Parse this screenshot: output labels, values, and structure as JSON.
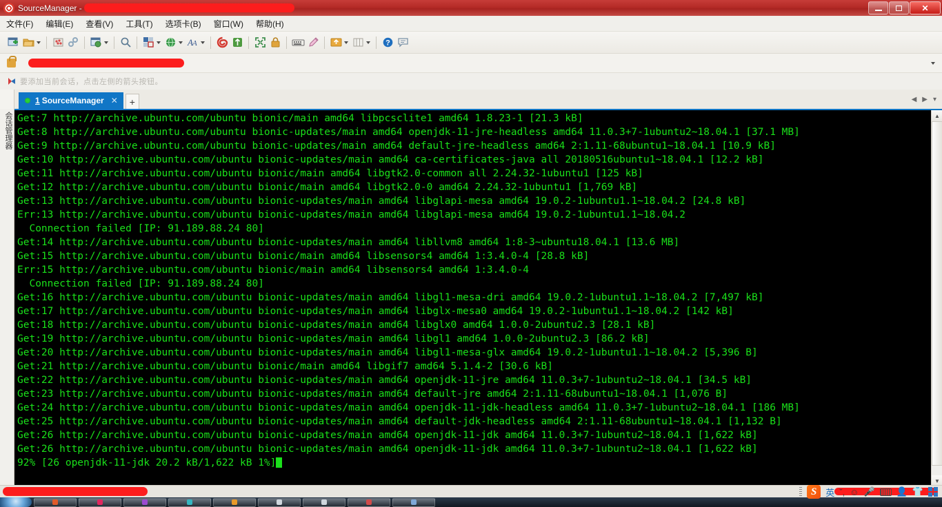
{
  "window": {
    "app_icon": "spiral-icon",
    "title": "SourceManager -",
    "title_redacted": true,
    "controls": {
      "minimize": "minimize-button",
      "maximize": "maximize-button",
      "close": "✕"
    }
  },
  "menubar": {
    "items": [
      {
        "label": "文件(F)",
        "name": "menu-file"
      },
      {
        "label": "编辑(E)",
        "name": "menu-edit"
      },
      {
        "label": "查看(V)",
        "name": "menu-view"
      },
      {
        "label": "工具(T)",
        "name": "menu-tools"
      },
      {
        "label": "选项卡(B)",
        "name": "menu-tabs"
      },
      {
        "label": "窗口(W)",
        "name": "menu-window"
      },
      {
        "label": "帮助(H)",
        "name": "menu-help"
      }
    ]
  },
  "toolbar": {
    "buttons": [
      {
        "name": "new-session-icon",
        "glyph": "▤",
        "color": "#4a80c0",
        "dropdown": false
      },
      {
        "name": "open-folder-icon",
        "glyph": "▰",
        "color": "#e2a33c",
        "dropdown": true
      },
      {
        "name": "disconnect-icon",
        "glyph": "✻",
        "color": "#d05a5a",
        "dropdown": false
      },
      {
        "name": "connect-chain-icon",
        "glyph": "⚯",
        "color": "#8fa8bd",
        "dropdown": false
      },
      {
        "name": "clone-session-icon",
        "glyph": "▣",
        "color": "#3f8f4f",
        "dropdown": true
      },
      {
        "name": "search-icon",
        "glyph": "🔍",
        "color": "#5b7a93",
        "dropdown": false
      },
      {
        "name": "layout-icon",
        "glyph": "▦",
        "color": "#c85050",
        "dropdown": true
      },
      {
        "name": "globe-icon",
        "glyph": "●",
        "color": "#2f8f4f",
        "dropdown": true
      },
      {
        "name": "font-icon",
        "glyph": "A",
        "color": "#3a5a8f",
        "dropdown": true
      },
      {
        "name": "log-session-icon",
        "glyph": "◉",
        "color": "#d4382f",
        "dropdown": false
      },
      {
        "name": "transfer-icon",
        "glyph": "⇄",
        "color": "#4e9a3f",
        "dropdown": false
      },
      {
        "name": "fullscreen-icon",
        "glyph": "⤢",
        "color": "#3f8f4f",
        "dropdown": false
      },
      {
        "name": "lock-icon",
        "glyph": "🔒",
        "color": "#d0a044",
        "dropdown": false
      },
      {
        "name": "keyboard-icon",
        "glyph": "⌨",
        "color": "#6b6b6b",
        "dropdown": false
      },
      {
        "name": "highlighter-icon",
        "glyph": "✎",
        "color": "#c46ba0",
        "dropdown": false
      },
      {
        "name": "upload-icon",
        "glyph": "▲",
        "color": "#e0a43c",
        "dropdown": true
      },
      {
        "name": "columns-icon",
        "glyph": "▥",
        "color": "#9a9a9a",
        "dropdown": true
      },
      {
        "name": "help-icon",
        "glyph": "?",
        "color": "#1f6fbf",
        "dropdown": false
      },
      {
        "name": "chat-icon",
        "glyph": "💬",
        "color": "#7b93a8",
        "dropdown": false
      }
    ]
  },
  "notification": {
    "lock_icon": "lock-icon",
    "redacted": true,
    "dropdown_caret": "▼"
  },
  "hint": {
    "icon": "flag-icon",
    "text": "要添加当前会话，点击左侧的箭头按钮。"
  },
  "sidebar": {
    "handle_glyph": "⟩⟨",
    "label": "会话管理器"
  },
  "tabs": {
    "items": [
      {
        "number": "1",
        "label": "SourceManager",
        "status_dot": "#2ad23a",
        "close": "✕",
        "active": true
      }
    ],
    "add_label": "+",
    "nav_left": "◀",
    "nav_right": "▶",
    "nav_menu": "▾"
  },
  "terminal": {
    "foreground": "#1ae01a",
    "background": "#000000",
    "lines": [
      "Get:7 http://archive.ubuntu.com/ubuntu bionic/main amd64 libpcsclite1 amd64 1.8.23-1 [21.3 kB]",
      "Get:8 http://archive.ubuntu.com/ubuntu bionic-updates/main amd64 openjdk-11-jre-headless amd64 11.0.3+7-1ubuntu2~18.04.1 [37.1 MB]",
      "Get:9 http://archive.ubuntu.com/ubuntu bionic-updates/main amd64 default-jre-headless amd64 2:1.11-68ubuntu1~18.04.1 [10.9 kB]",
      "Get:10 http://archive.ubuntu.com/ubuntu bionic-updates/main amd64 ca-certificates-java all 20180516ubuntu1~18.04.1 [12.2 kB]",
      "Get:11 http://archive.ubuntu.com/ubuntu bionic/main amd64 libgtk2.0-common all 2.24.32-1ubuntu1 [125 kB]",
      "Get:12 http://archive.ubuntu.com/ubuntu bionic/main amd64 libgtk2.0-0 amd64 2.24.32-1ubuntu1 [1,769 kB]",
      "Get:13 http://archive.ubuntu.com/ubuntu bionic-updates/main amd64 libglapi-mesa amd64 19.0.2-1ubuntu1.1~18.04.2 [24.8 kB]",
      "Err:13 http://archive.ubuntu.com/ubuntu bionic-updates/main amd64 libglapi-mesa amd64 19.0.2-1ubuntu1.1~18.04.2",
      "  Connection failed [IP: 91.189.88.24 80]",
      "Get:14 http://archive.ubuntu.com/ubuntu bionic-updates/main amd64 libllvm8 amd64 1:8-3~ubuntu18.04.1 [13.6 MB]",
      "Get:15 http://archive.ubuntu.com/ubuntu bionic/main amd64 libsensors4 amd64 1:3.4.0-4 [28.8 kB]",
      "Err:15 http://archive.ubuntu.com/ubuntu bionic/main amd64 libsensors4 amd64 1:3.4.0-4",
      "  Connection failed [IP: 91.189.88.24 80]",
      "Get:16 http://archive.ubuntu.com/ubuntu bionic-updates/main amd64 libgl1-mesa-dri amd64 19.0.2-1ubuntu1.1~18.04.2 [7,497 kB]",
      "Get:17 http://archive.ubuntu.com/ubuntu bionic-updates/main amd64 libglx-mesa0 amd64 19.0.2-1ubuntu1.1~18.04.2 [142 kB]",
      "Get:18 http://archive.ubuntu.com/ubuntu bionic-updates/main amd64 libglx0 amd64 1.0.0-2ubuntu2.3 [28.1 kB]",
      "Get:19 http://archive.ubuntu.com/ubuntu bionic-updates/main amd64 libgl1 amd64 1.0.0-2ubuntu2.3 [86.2 kB]",
      "Get:20 http://archive.ubuntu.com/ubuntu bionic-updates/main amd64 libgl1-mesa-glx amd64 19.0.2-1ubuntu1.1~18.04.2 [5,396 B]",
      "Get:21 http://archive.ubuntu.com/ubuntu bionic/main amd64 libgif7 amd64 5.1.4-2 [30.6 kB]",
      "Get:22 http://archive.ubuntu.com/ubuntu bionic-updates/main amd64 openjdk-11-jre amd64 11.0.3+7-1ubuntu2~18.04.1 [34.5 kB]",
      "Get:23 http://archive.ubuntu.com/ubuntu bionic-updates/main amd64 default-jre amd64 2:1.11-68ubuntu1~18.04.1 [1,076 B]",
      "Get:24 http://archive.ubuntu.com/ubuntu bionic-updates/main amd64 openjdk-11-jdk-headless amd64 11.0.3+7-1ubuntu2~18.04.1 [186 MB]",
      "Get:25 http://archive.ubuntu.com/ubuntu bionic-updates/main amd64 default-jdk-headless amd64 2:1.11-68ubuntu1~18.04.1 [1,132 B]",
      "Get:26 http://archive.ubuntu.com/ubuntu bionic-updates/main amd64 openjdk-11-jdk amd64 11.0.3+7-1ubuntu2~18.04.1 [1,622 kB]",
      "Get:26 http://archive.ubuntu.com/ubuntu bionic-updates/main amd64 openjdk-11-jdk amd64 11.0.3+7-1ubuntu2~18.04.1 [1,622 kB]"
    ],
    "progress_line": "92% [26 openjdk-11-jdk 20.2 kB/1,622 kB 1%]",
    "progress_total_percent": "92%",
    "progress_item": "26 openjdk-11-jdk",
    "progress_downloaded": "20.2 kB",
    "progress_size": "1,622 kB",
    "progress_item_percent": "1%",
    "scrollbar": {
      "up": "▲",
      "down": "▼"
    }
  },
  "statusbar": {
    "redacted": true,
    "right_redacted": true
  },
  "ime": {
    "logo": "S",
    "mode_label": "英",
    "items": [
      "comma-icon",
      "smiley-icon",
      "mic-icon",
      "keyboard-icon",
      "user-icon",
      "skin-icon",
      "apps-icon"
    ]
  },
  "taskbar": {
    "start": "start-button",
    "tasks": [
      "task-1",
      "task-2",
      "task-3",
      "task-4",
      "task-5",
      "task-6",
      "task-7",
      "task-8"
    ],
    "tray_time": ""
  }
}
